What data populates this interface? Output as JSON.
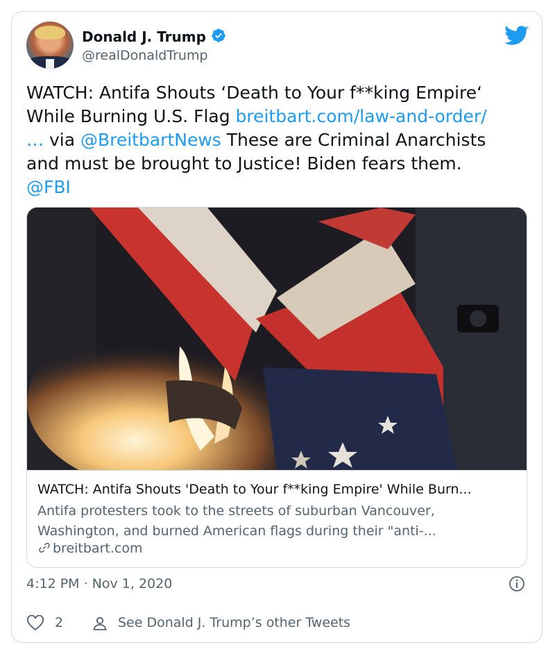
{
  "author": {
    "name": "Donald J. Trump",
    "handle": "@realDonaldTrump"
  },
  "tweet": {
    "line1": "WATCH: Antifa Shouts ‘Death to Your f**king Empire‘",
    "line2_text": "While Burning U.S. Flag ",
    "line2_link": "breitbart.com/law-and-order/",
    "line3_link1": "…",
    "line3_text1": " via ",
    "line3_link2": "@BreitbartNews",
    "line3_text2": " These are Criminal Anarchists",
    "line4": "and must be brought to Justice! Biden fears them.",
    "line5_link": "@FBI"
  },
  "link_card": {
    "title": "WATCH: Antifa Shouts 'Death to Your f**king Empire' While Burn...",
    "description_line1": "Antifa protesters took to the streets of suburban Vancouver,",
    "description_line2": "Washington, and burned American flags during their \"anti-...",
    "domain": "breitbart.com"
  },
  "timestamp": "4:12 PM · Nov 1, 2020",
  "actions": {
    "like_count": "2",
    "see_other_tweets": "See Donald J. Trump’s other Tweets"
  },
  "icons": {
    "verified": "verified-badge-icon",
    "twitter": "twitter-bird-icon",
    "info": "info-icon",
    "like": "heart-icon",
    "profile": "person-icon",
    "link": "link-icon"
  },
  "colors": {
    "link": "#1d9bf0",
    "muted": "#536471",
    "border": "#cfd9de",
    "text": "#0f1419"
  }
}
